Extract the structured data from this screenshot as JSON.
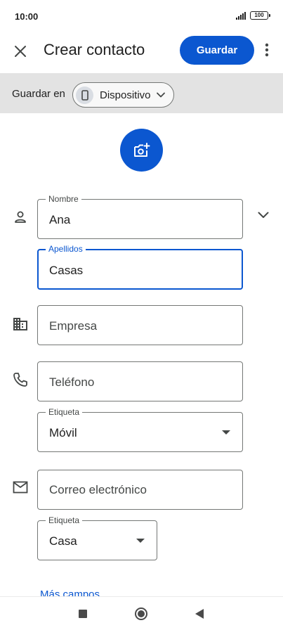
{
  "status_bar": {
    "time": "10:00",
    "battery": "100",
    "icons": [
      "signal-icon",
      "battery-icon"
    ]
  },
  "app_bar": {
    "title": "Crear contacto",
    "save_label": "Guardar",
    "icons": [
      "close-icon",
      "more-vert-icon"
    ]
  },
  "save_in": {
    "label": "Guardar en",
    "device": "Dispositivo",
    "icons": [
      "phone-icon",
      "chevron-down-icon"
    ]
  },
  "photo": {
    "icon": "add-photo-icon"
  },
  "form": {
    "name": {
      "label": "Nombre",
      "value": "Ana",
      "icon": "person-icon"
    },
    "surname": {
      "label": "Apellidos",
      "value": "Casas"
    },
    "company": {
      "placeholder": "Empresa",
      "icon": "business-icon"
    },
    "phone": {
      "placeholder": "Teléfono",
      "icon": "phone-icon"
    },
    "phone_label": {
      "label": "Etiqueta",
      "value": "Móvil"
    },
    "email": {
      "placeholder": "Correo electrónico",
      "icon": "mail-icon"
    },
    "email_label": {
      "label": "Etiqueta",
      "value": "Casa"
    }
  },
  "more_fields": "Más campos",
  "colors": {
    "accent": "#0b57d0",
    "save_in_background": "#e3e3e3",
    "outline": "#747775",
    "text": "#1f1f1f"
  }
}
